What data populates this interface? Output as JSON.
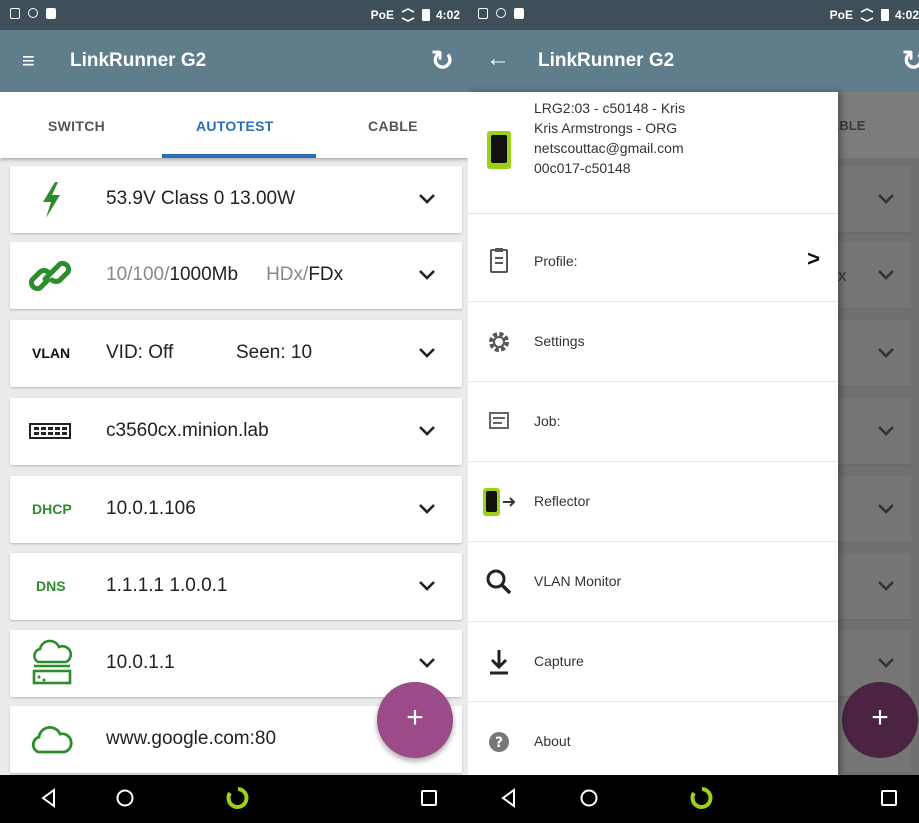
{
  "status_bar": {
    "poe": "PoE",
    "time": "4:02",
    "time_right": "4:02"
  },
  "app": {
    "title": "LinkRunner G2"
  },
  "tabs": [
    {
      "label": "SWITCH",
      "active": false
    },
    {
      "label": "AUTOTEST",
      "active": true
    },
    {
      "label": "CABLE",
      "active": false
    }
  ],
  "cards": {
    "poe": {
      "icon": "lightning-bolt-icon",
      "text": "53.9V  Class 0  13.00W"
    },
    "link": {
      "icon": "chain-link-icon",
      "speeds_dim": "10/100/",
      "speed_bold": "1000Mb",
      "duplex_dim": "HDx/",
      "duplex_bold": "FDx"
    },
    "vlan": {
      "label": "VLAN",
      "vid": "VID: Off",
      "seen": "Seen: 10"
    },
    "switch": {
      "icon": "switch-icon",
      "text": "c3560cx.minion.lab"
    },
    "dhcp": {
      "label": "DHCP",
      "text": "10.0.1.106"
    },
    "dns": {
      "label": "DNS",
      "text": "1.1.1.1  1.0.0.1"
    },
    "gateway": {
      "icon": "gateway-cloud-icon",
      "text": "10.0.1.1"
    },
    "target": {
      "icon": "cloud-icon",
      "text": "www.google.com:80"
    }
  },
  "fab": {
    "label": "+"
  },
  "drawer": {
    "header": {
      "line1": "LRG2:03 - c50148 - Kris",
      "line2": "Kris Armstrongs - ORG",
      "line3": "netscouttac@gmail.com",
      "line4": "00c017-c50148"
    },
    "items": [
      {
        "label": "Profile:",
        "icon": "clipboard-icon",
        "arrow": ">"
      },
      {
        "label": "Settings",
        "icon": "gear-icon"
      },
      {
        "label": "Job:",
        "icon": "message-icon"
      },
      {
        "label": "Reflector",
        "icon": "reflector-icon"
      },
      {
        "label": "VLAN Monitor",
        "icon": "magnifier-icon"
      },
      {
        "label": "Capture",
        "icon": "download-icon"
      },
      {
        "label": "About",
        "icon": "help-icon"
      }
    ]
  },
  "background_peek": {
    "tab_fragment": "ABLE",
    "card_fragment": "x"
  },
  "colors": {
    "appbar": "#607d8b",
    "status": "#3f4f5a",
    "accent": "#2a6fb6",
    "green": "#2e8b2e",
    "fab": "#9a4b88"
  }
}
